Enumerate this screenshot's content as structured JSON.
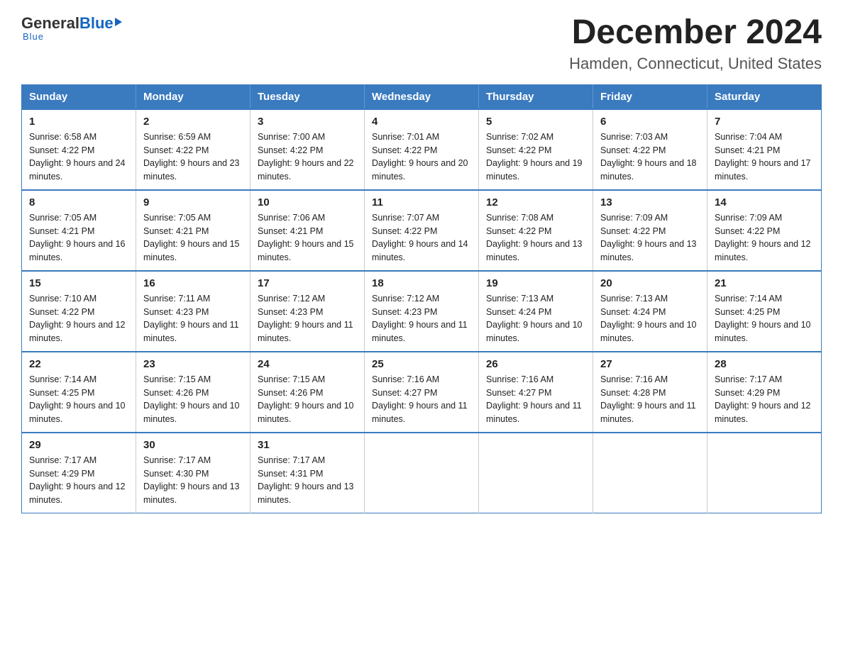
{
  "header": {
    "logo_general": "General",
    "logo_blue": "Blue",
    "month_title": "December 2024",
    "location": "Hamden, Connecticut, United States"
  },
  "days_of_week": [
    "Sunday",
    "Monday",
    "Tuesday",
    "Wednesday",
    "Thursday",
    "Friday",
    "Saturday"
  ],
  "weeks": [
    [
      {
        "day": "1",
        "sunrise": "6:58 AM",
        "sunset": "4:22 PM",
        "daylight": "9 hours and 24 minutes."
      },
      {
        "day": "2",
        "sunrise": "6:59 AM",
        "sunset": "4:22 PM",
        "daylight": "9 hours and 23 minutes."
      },
      {
        "day": "3",
        "sunrise": "7:00 AM",
        "sunset": "4:22 PM",
        "daylight": "9 hours and 22 minutes."
      },
      {
        "day": "4",
        "sunrise": "7:01 AM",
        "sunset": "4:22 PM",
        "daylight": "9 hours and 20 minutes."
      },
      {
        "day": "5",
        "sunrise": "7:02 AM",
        "sunset": "4:22 PM",
        "daylight": "9 hours and 19 minutes."
      },
      {
        "day": "6",
        "sunrise": "7:03 AM",
        "sunset": "4:22 PM",
        "daylight": "9 hours and 18 minutes."
      },
      {
        "day": "7",
        "sunrise": "7:04 AM",
        "sunset": "4:21 PM",
        "daylight": "9 hours and 17 minutes."
      }
    ],
    [
      {
        "day": "8",
        "sunrise": "7:05 AM",
        "sunset": "4:21 PM",
        "daylight": "9 hours and 16 minutes."
      },
      {
        "day": "9",
        "sunrise": "7:05 AM",
        "sunset": "4:21 PM",
        "daylight": "9 hours and 15 minutes."
      },
      {
        "day": "10",
        "sunrise": "7:06 AM",
        "sunset": "4:21 PM",
        "daylight": "9 hours and 15 minutes."
      },
      {
        "day": "11",
        "sunrise": "7:07 AM",
        "sunset": "4:22 PM",
        "daylight": "9 hours and 14 minutes."
      },
      {
        "day": "12",
        "sunrise": "7:08 AM",
        "sunset": "4:22 PM",
        "daylight": "9 hours and 13 minutes."
      },
      {
        "day": "13",
        "sunrise": "7:09 AM",
        "sunset": "4:22 PM",
        "daylight": "9 hours and 13 minutes."
      },
      {
        "day": "14",
        "sunrise": "7:09 AM",
        "sunset": "4:22 PM",
        "daylight": "9 hours and 12 minutes."
      }
    ],
    [
      {
        "day": "15",
        "sunrise": "7:10 AM",
        "sunset": "4:22 PM",
        "daylight": "9 hours and 12 minutes."
      },
      {
        "day": "16",
        "sunrise": "7:11 AM",
        "sunset": "4:23 PM",
        "daylight": "9 hours and 11 minutes."
      },
      {
        "day": "17",
        "sunrise": "7:12 AM",
        "sunset": "4:23 PM",
        "daylight": "9 hours and 11 minutes."
      },
      {
        "day": "18",
        "sunrise": "7:12 AM",
        "sunset": "4:23 PM",
        "daylight": "9 hours and 11 minutes."
      },
      {
        "day": "19",
        "sunrise": "7:13 AM",
        "sunset": "4:24 PM",
        "daylight": "9 hours and 10 minutes."
      },
      {
        "day": "20",
        "sunrise": "7:13 AM",
        "sunset": "4:24 PM",
        "daylight": "9 hours and 10 minutes."
      },
      {
        "day": "21",
        "sunrise": "7:14 AM",
        "sunset": "4:25 PM",
        "daylight": "9 hours and 10 minutes."
      }
    ],
    [
      {
        "day": "22",
        "sunrise": "7:14 AM",
        "sunset": "4:25 PM",
        "daylight": "9 hours and 10 minutes."
      },
      {
        "day": "23",
        "sunrise": "7:15 AM",
        "sunset": "4:26 PM",
        "daylight": "9 hours and 10 minutes."
      },
      {
        "day": "24",
        "sunrise": "7:15 AM",
        "sunset": "4:26 PM",
        "daylight": "9 hours and 10 minutes."
      },
      {
        "day": "25",
        "sunrise": "7:16 AM",
        "sunset": "4:27 PM",
        "daylight": "9 hours and 11 minutes."
      },
      {
        "day": "26",
        "sunrise": "7:16 AM",
        "sunset": "4:27 PM",
        "daylight": "9 hours and 11 minutes."
      },
      {
        "day": "27",
        "sunrise": "7:16 AM",
        "sunset": "4:28 PM",
        "daylight": "9 hours and 11 minutes."
      },
      {
        "day": "28",
        "sunrise": "7:17 AM",
        "sunset": "4:29 PM",
        "daylight": "9 hours and 12 minutes."
      }
    ],
    [
      {
        "day": "29",
        "sunrise": "7:17 AM",
        "sunset": "4:29 PM",
        "daylight": "9 hours and 12 minutes."
      },
      {
        "day": "30",
        "sunrise": "7:17 AM",
        "sunset": "4:30 PM",
        "daylight": "9 hours and 13 minutes."
      },
      {
        "day": "31",
        "sunrise": "7:17 AM",
        "sunset": "4:31 PM",
        "daylight": "9 hours and 13 minutes."
      },
      null,
      null,
      null,
      null
    ]
  ]
}
